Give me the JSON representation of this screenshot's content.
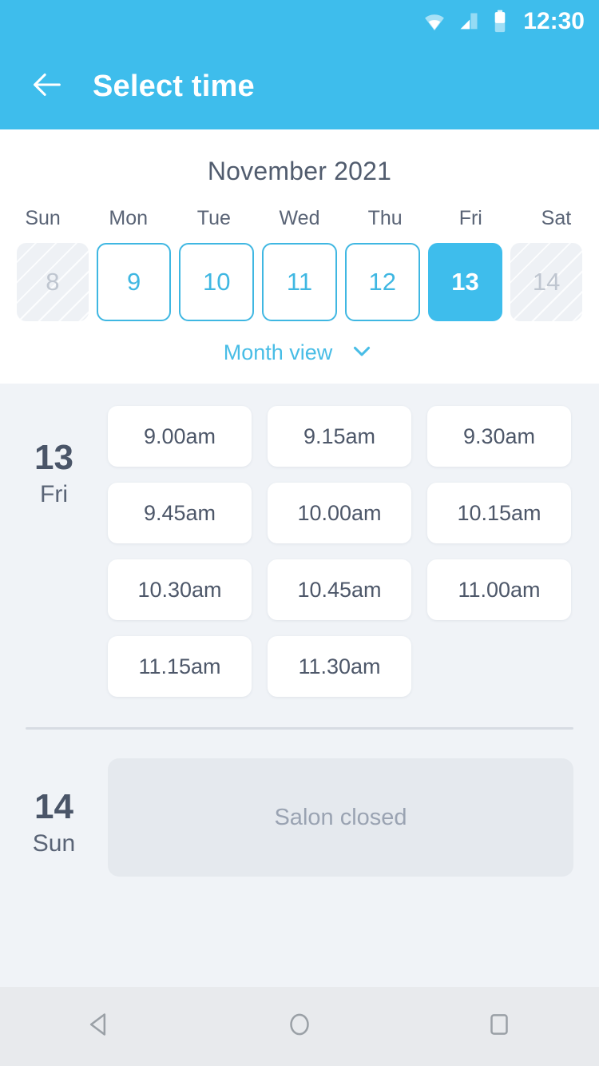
{
  "status_bar": {
    "time": "12:30",
    "icons": [
      "wifi-icon",
      "signal-icon",
      "battery-icon"
    ]
  },
  "app_bar": {
    "back_icon": "back-arrow-icon",
    "title": "Select time"
  },
  "calendar": {
    "month_title": "November 2021",
    "weekdays": [
      "Sun",
      "Mon",
      "Tue",
      "Wed",
      "Thu",
      "Fri",
      "Sat"
    ],
    "days": [
      {
        "number": "8",
        "state": "disabled"
      },
      {
        "number": "9",
        "state": "available"
      },
      {
        "number": "10",
        "state": "available"
      },
      {
        "number": "11",
        "state": "available"
      },
      {
        "number": "12",
        "state": "available"
      },
      {
        "number": "13",
        "state": "selected"
      },
      {
        "number": "14",
        "state": "disabled"
      }
    ],
    "month_view_label": "Month view",
    "month_view_icon": "chevron-down-icon"
  },
  "slots_section": {
    "day": {
      "number": "13",
      "weekday": "Fri"
    },
    "times": [
      "9.00am",
      "9.15am",
      "9.30am",
      "9.45am",
      "10.00am",
      "10.15am",
      "10.30am",
      "10.45am",
      "11.00am",
      "11.15am",
      "11.30am"
    ]
  },
  "closed_section": {
    "day": {
      "number": "14",
      "weekday": "Sun"
    },
    "message": "Salon closed"
  },
  "nav_bar": {
    "back_icon": "nav-back-triangle-icon",
    "home_icon": "nav-home-circle-icon",
    "recents_icon": "nav-recents-square-icon"
  },
  "colors": {
    "accent": "#3ebdec",
    "accent_border": "#3fb7e2",
    "page_background": "#f0f3f7",
    "card_background": "#ffffff",
    "text_dark": "#4a5568",
    "text_muted": "#9aa3b2",
    "nav_background": "#e8eaed"
  }
}
